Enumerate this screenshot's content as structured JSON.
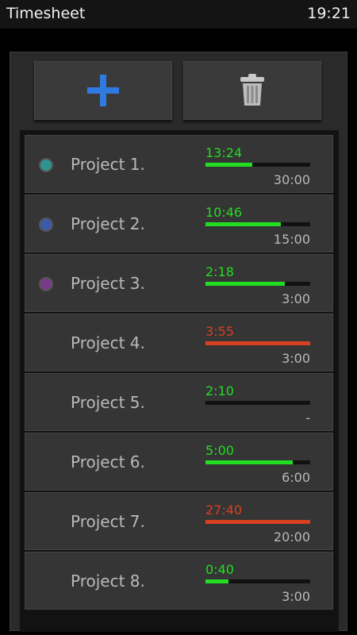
{
  "status": {
    "app_title": "Timesheet",
    "clock": "19:21"
  },
  "toolbar": {
    "add_icon": "plus-icon",
    "delete_icon": "trash-icon"
  },
  "projects": [
    {
      "name": "Project 1.",
      "time": "13:24",
      "goal": "30:00",
      "progress": 0.45,
      "status": "ok",
      "dot_color": "#2f9490",
      "bar_color": "#22dd22",
      "time_color": "#22dd22"
    },
    {
      "name": "Project 2.",
      "time": "10:46",
      "goal": "15:00",
      "progress": 0.72,
      "status": "ok",
      "dot_color": "#3b5aa8",
      "bar_color": "#22dd22",
      "time_color": "#22dd22"
    },
    {
      "name": "Project 3.",
      "time": "2:18",
      "goal": "3:00",
      "progress": 0.76,
      "status": "ok",
      "dot_color": "#7a3a88",
      "bar_color": "#22dd22",
      "time_color": "#22dd22"
    },
    {
      "name": "Project 4.",
      "time": "3:55",
      "goal": "3:00",
      "progress": 1.0,
      "status": "over",
      "dot_color": null,
      "bar_color": "#d8401f",
      "time_color": "#d8401f"
    },
    {
      "name": "Project 5.",
      "time": "2:10",
      "goal": "-",
      "progress": 0.0,
      "status": "ok",
      "dot_color": null,
      "bar_color": "#22dd22",
      "time_color": "#22dd22"
    },
    {
      "name": "Project 6.",
      "time": "5:00",
      "goal": "6:00",
      "progress": 0.83,
      "status": "ok",
      "dot_color": null,
      "bar_color": "#22dd22",
      "time_color": "#22dd22"
    },
    {
      "name": "Project 7.",
      "time": "27:40",
      "goal": "20:00",
      "progress": 1.0,
      "status": "over",
      "dot_color": null,
      "bar_color": "#d8401f",
      "time_color": "#d8401f"
    },
    {
      "name": "Project 8.",
      "time": "0:40",
      "goal": "3:00",
      "progress": 0.22,
      "status": "ok",
      "dot_color": null,
      "bar_color": "#22dd22",
      "time_color": "#22dd22"
    }
  ]
}
